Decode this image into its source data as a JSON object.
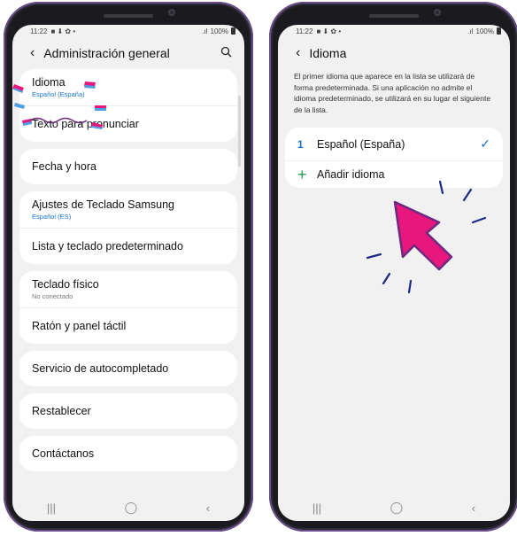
{
  "left": {
    "status": {
      "time": "11:22",
      "icons": "■ ⬇ ✿ •",
      "battery": "100%"
    },
    "header": {
      "title": "Administración general"
    },
    "cards": [
      {
        "items": [
          {
            "title": "Idioma",
            "subtitle": "Español (España)"
          },
          {
            "title": "Texto para pronunciar",
            "subtitle": ""
          }
        ]
      },
      {
        "items": [
          {
            "title": "Fecha y hora",
            "subtitle": ""
          }
        ]
      },
      {
        "items": [
          {
            "title": "Ajustes de Teclado Samsung",
            "subtitle": "Español (ES)"
          },
          {
            "title": "Lista y teclado predeterminado",
            "subtitle": ""
          }
        ]
      },
      {
        "items": [
          {
            "title": "Teclado físico",
            "subtitle": "No conectado"
          },
          {
            "title": "Ratón y panel táctil",
            "subtitle": ""
          }
        ]
      },
      {
        "items": [
          {
            "title": "Servicio de autocompletado",
            "subtitle": ""
          }
        ]
      },
      {
        "items": [
          {
            "title": "Restablecer",
            "subtitle": ""
          }
        ]
      },
      {
        "items": [
          {
            "title": "Contáctanos",
            "subtitle": ""
          }
        ]
      }
    ]
  },
  "right": {
    "status": {
      "time": "11:22",
      "icons": "■ ⬇ ✿ •",
      "battery": "100%"
    },
    "header": {
      "title": "Idioma"
    },
    "description": "El primer idioma que aparece en la lista se utilizará de forma predeterminada. Si una aplicación no admite el idioma predeterminado, se utilizará en su lugar el siguiente de la lista.",
    "languages": [
      {
        "number": "1",
        "name": "Español (España)"
      }
    ],
    "add_label": "Añadir idioma"
  },
  "nav": {
    "recents": "|||",
    "home": "◯",
    "back": "‹"
  },
  "colors": {
    "highlight_pink": "#e8177d",
    "highlight_blue": "#4ea0e0",
    "accent_blue": "#1a73c8",
    "callout_navy": "#1d2a8a"
  }
}
